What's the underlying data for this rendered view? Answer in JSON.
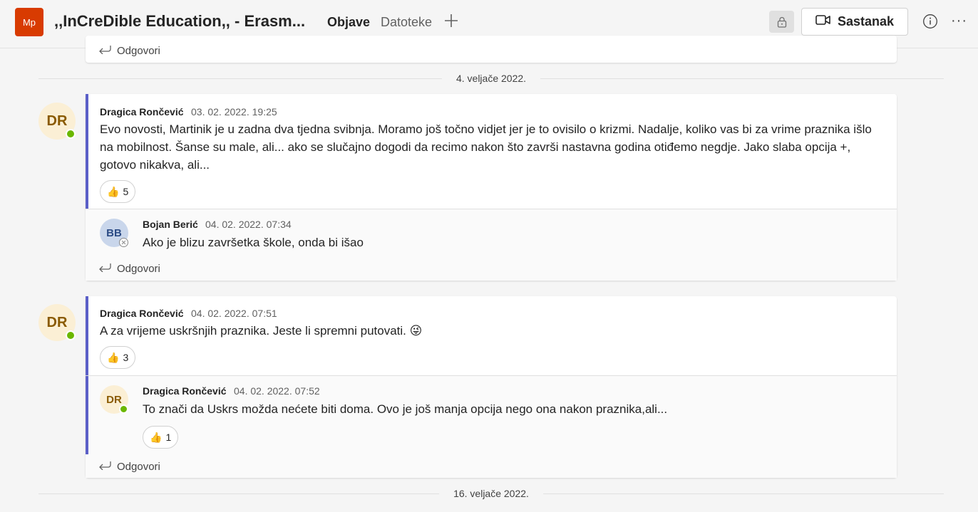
{
  "header": {
    "team_initials": "Mp",
    "team_title": ",,InCreDible Education,, - Erasm...",
    "tabs": [
      "Objave",
      "Datoteke"
    ],
    "meet_label": "Sastanak",
    "more_label": "···"
  },
  "reply_label": "Odgovori",
  "dates": [
    "4. veljače 2022.",
    "16. veljače 2022."
  ],
  "threads": [
    {
      "author_initials": "DR",
      "author": "Dragica Rončević",
      "time": "03. 02. 2022. 19:25",
      "text": "Evo novosti, Martinik je u zadna dva tjedna svibnja. Moramo još točno vidjet jer je to ovisilo o krizmi. Nadalje, koliko vas bi za vrime praznika išlo na mobilnost. Šanse su male, ali... ako se slučajno dogodi da recimo nakon što završi nastavna  godina otiđemo negdje. Jako slaba opcija +, gotovo nikakva, ali...",
      "reaction": "👍",
      "reaction_count": "5",
      "replies": [
        {
          "author_initials": "BB",
          "author": "Bojan Berić",
          "time": "04. 02. 2022. 07:34",
          "text": "Ako je blizu završetka škole, onda bi išao"
        }
      ]
    },
    {
      "author_initials": "DR",
      "author": "Dragica Rončević",
      "time": "04. 02. 2022. 07:51",
      "text": "A za vrijeme uskršnjih praznika. Jeste li spremni putovati. 😜",
      "reaction": "👍",
      "reaction_count": "3",
      "replies": [
        {
          "author_initials": "DR",
          "author": "Dragica Rončević",
          "time": "04. 02. 2022. 07:52",
          "text": "To znači da Uskrs možda nećete biti doma. Ovo je još manja opcija nego ona nakon praznika,ali...",
          "reaction": "👍",
          "reaction_count": "1"
        }
      ]
    }
  ],
  "colors": {
    "accent": "#5b5fc7",
    "team_avatar": "#d83b01",
    "online": "#6bb700"
  }
}
